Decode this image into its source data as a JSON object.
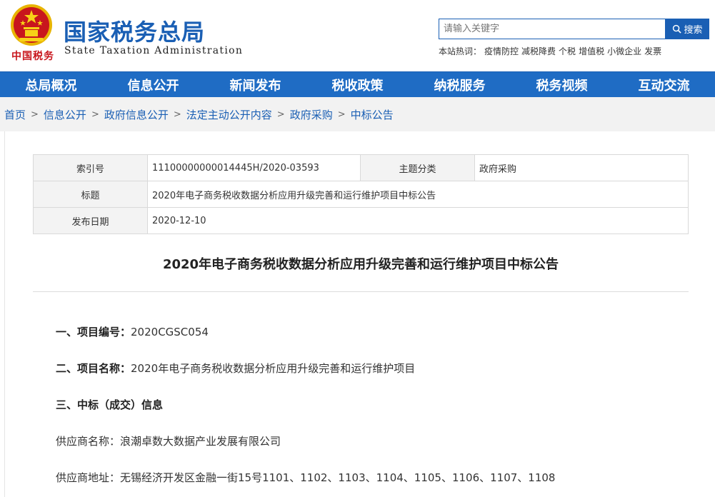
{
  "header": {
    "emblem_text": "中国税务",
    "title": "国家税务总局",
    "subtitle": "State Taxation Administration"
  },
  "search": {
    "placeholder": "请输入关键字",
    "button_label": "搜索",
    "hot_label": "本站热词：",
    "hot_words": [
      "疫情防控",
      "减税降费",
      "个税",
      "增值税",
      "小微企业",
      "发票"
    ]
  },
  "nav": {
    "items": [
      "总局概况",
      "信息公开",
      "新闻发布",
      "税收政策",
      "纳税服务",
      "税务视频",
      "互动交流"
    ]
  },
  "breadcrumb": {
    "items": [
      "首页",
      "信息公开",
      "政府信息公开",
      "法定主动公开内容",
      "政府采购",
      "中标公告"
    ],
    "separator": ">"
  },
  "meta": {
    "index_label": "索引号",
    "index_value": "11100000000014445H/2020-03593",
    "category_label": "主题分类",
    "category_value": "政府采购",
    "title_label": "标题",
    "title_value": "2020年电子商务税收数据分析应用升级完善和运行维护项目中标公告",
    "date_label": "发布日期",
    "date_value": "2020-12-10"
  },
  "article": {
    "title": "2020年电子商务税收数据分析应用升级完善和运行维护项目中标公告",
    "s1_label": "一、项目编号：",
    "s1_value": "2020CGSC054",
    "s2_label": "二、项目名称：",
    "s2_value": "2020年电子商务税收数据分析应用升级完善和运行维护项目",
    "s3_label": "三、中标（成交）信息",
    "supplier_name": "供应商名称：浪潮卓数大数据产业发展有限公司",
    "supplier_addr": "供应商地址：无锡经济开发区金融一街15号1101、1102、1103、1104、1105、1106、1107、1108"
  },
  "colors": {
    "brand_blue": "#1a5fb4",
    "nav_blue": "#1f6cc4",
    "emblem_red": "#c8161d",
    "emblem_gold": "#e8b400"
  }
}
